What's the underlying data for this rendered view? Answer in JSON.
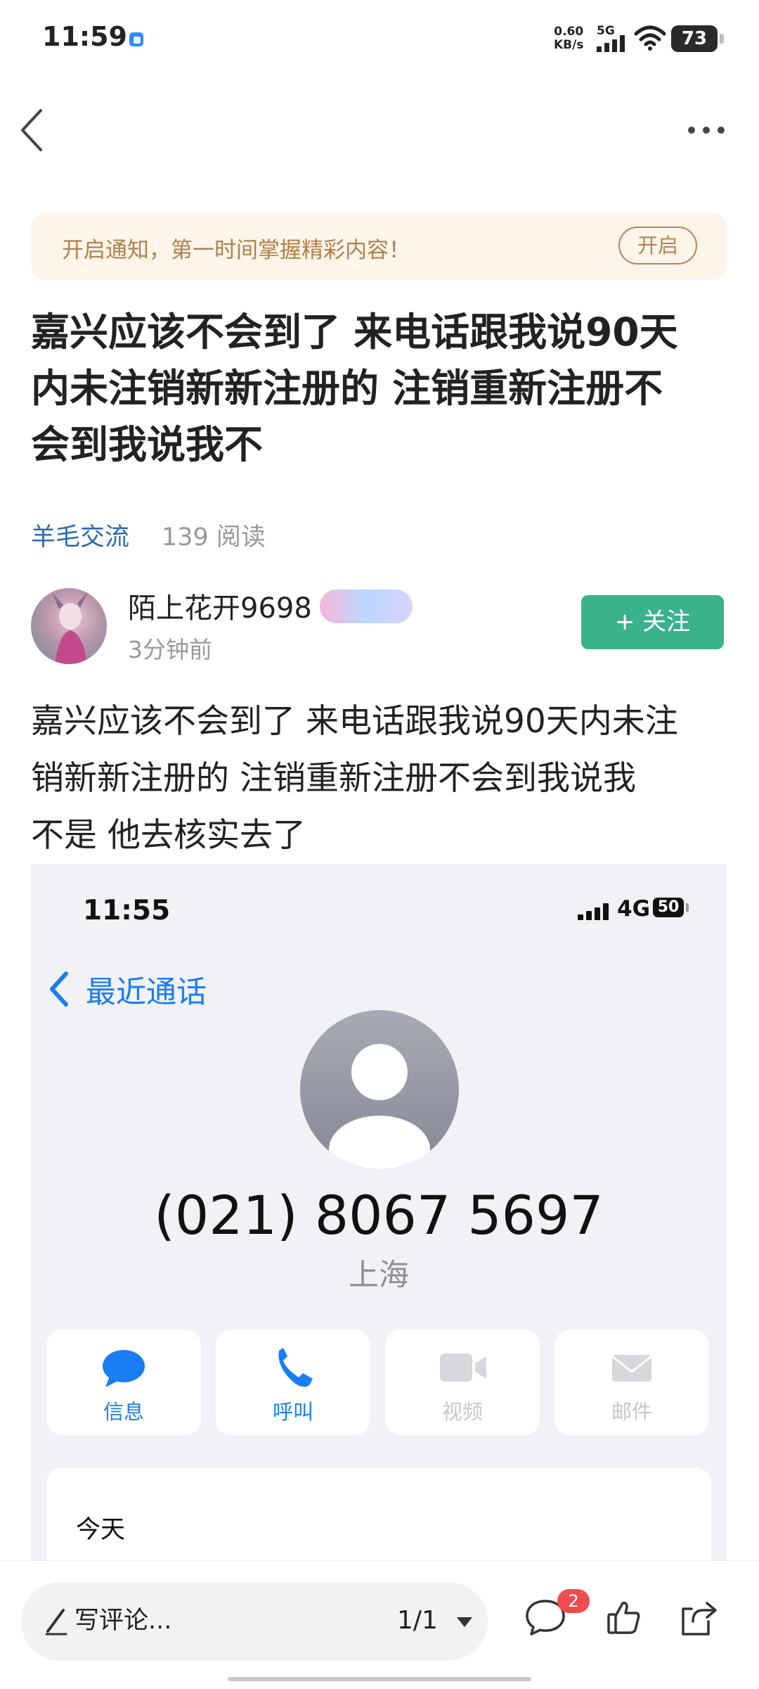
{
  "status_bar": {
    "time": "11:59",
    "net_speed_value": "0.60",
    "net_speed_unit": "KB/s",
    "network": "5G",
    "battery": "73"
  },
  "header": {
    "back_icon": "chevron-left-icon",
    "more_icon": "more-horizontal-icon"
  },
  "notice": {
    "text": "开启通知，第一时间掌握精彩内容！",
    "button": "开启"
  },
  "post": {
    "title_lines": [
      "嘉兴应该不会到了 来电话跟我说90天",
      "内未注销新新注册的 注销重新注册不",
      "会到我说我不"
    ],
    "category": "羊毛交流",
    "reads": "139 阅读",
    "author": {
      "name": "陌上花开9698",
      "time": "3分钟前",
      "follow_label": "+ 关注"
    },
    "body_lines": [
      "嘉兴应该不会到了 来电话跟我说90天内未注",
      "销新新注册的  注销重新注册不会到我说我",
      "不是 他去核实去了"
    ]
  },
  "embedded": {
    "time": "11:55",
    "network": "4G",
    "battery": "50",
    "back_label": "最近通话",
    "phone": "(021) 8067 5697",
    "location": "上海",
    "actions": [
      {
        "label": "信息",
        "icon": "message-bubble-icon",
        "enabled": true
      },
      {
        "label": "呼叫",
        "icon": "phone-icon",
        "enabled": true
      },
      {
        "label": "视频",
        "icon": "video-icon",
        "enabled": false
      },
      {
        "label": "邮件",
        "icon": "mail-icon",
        "enabled": false
      }
    ],
    "history_label": "今天"
  },
  "bottom_bar": {
    "comment_placeholder": "写评论...",
    "page_indicator": "1/1",
    "comment_count": "2"
  },
  "colors": {
    "accent_green": "#3ab28c",
    "link_blue": "#2c68b0",
    "ios_blue": "#1a7ef2",
    "notice_bg": "#fdf4ea",
    "notice_text": "#b0814a",
    "badge_red": "#ee4c4e"
  }
}
